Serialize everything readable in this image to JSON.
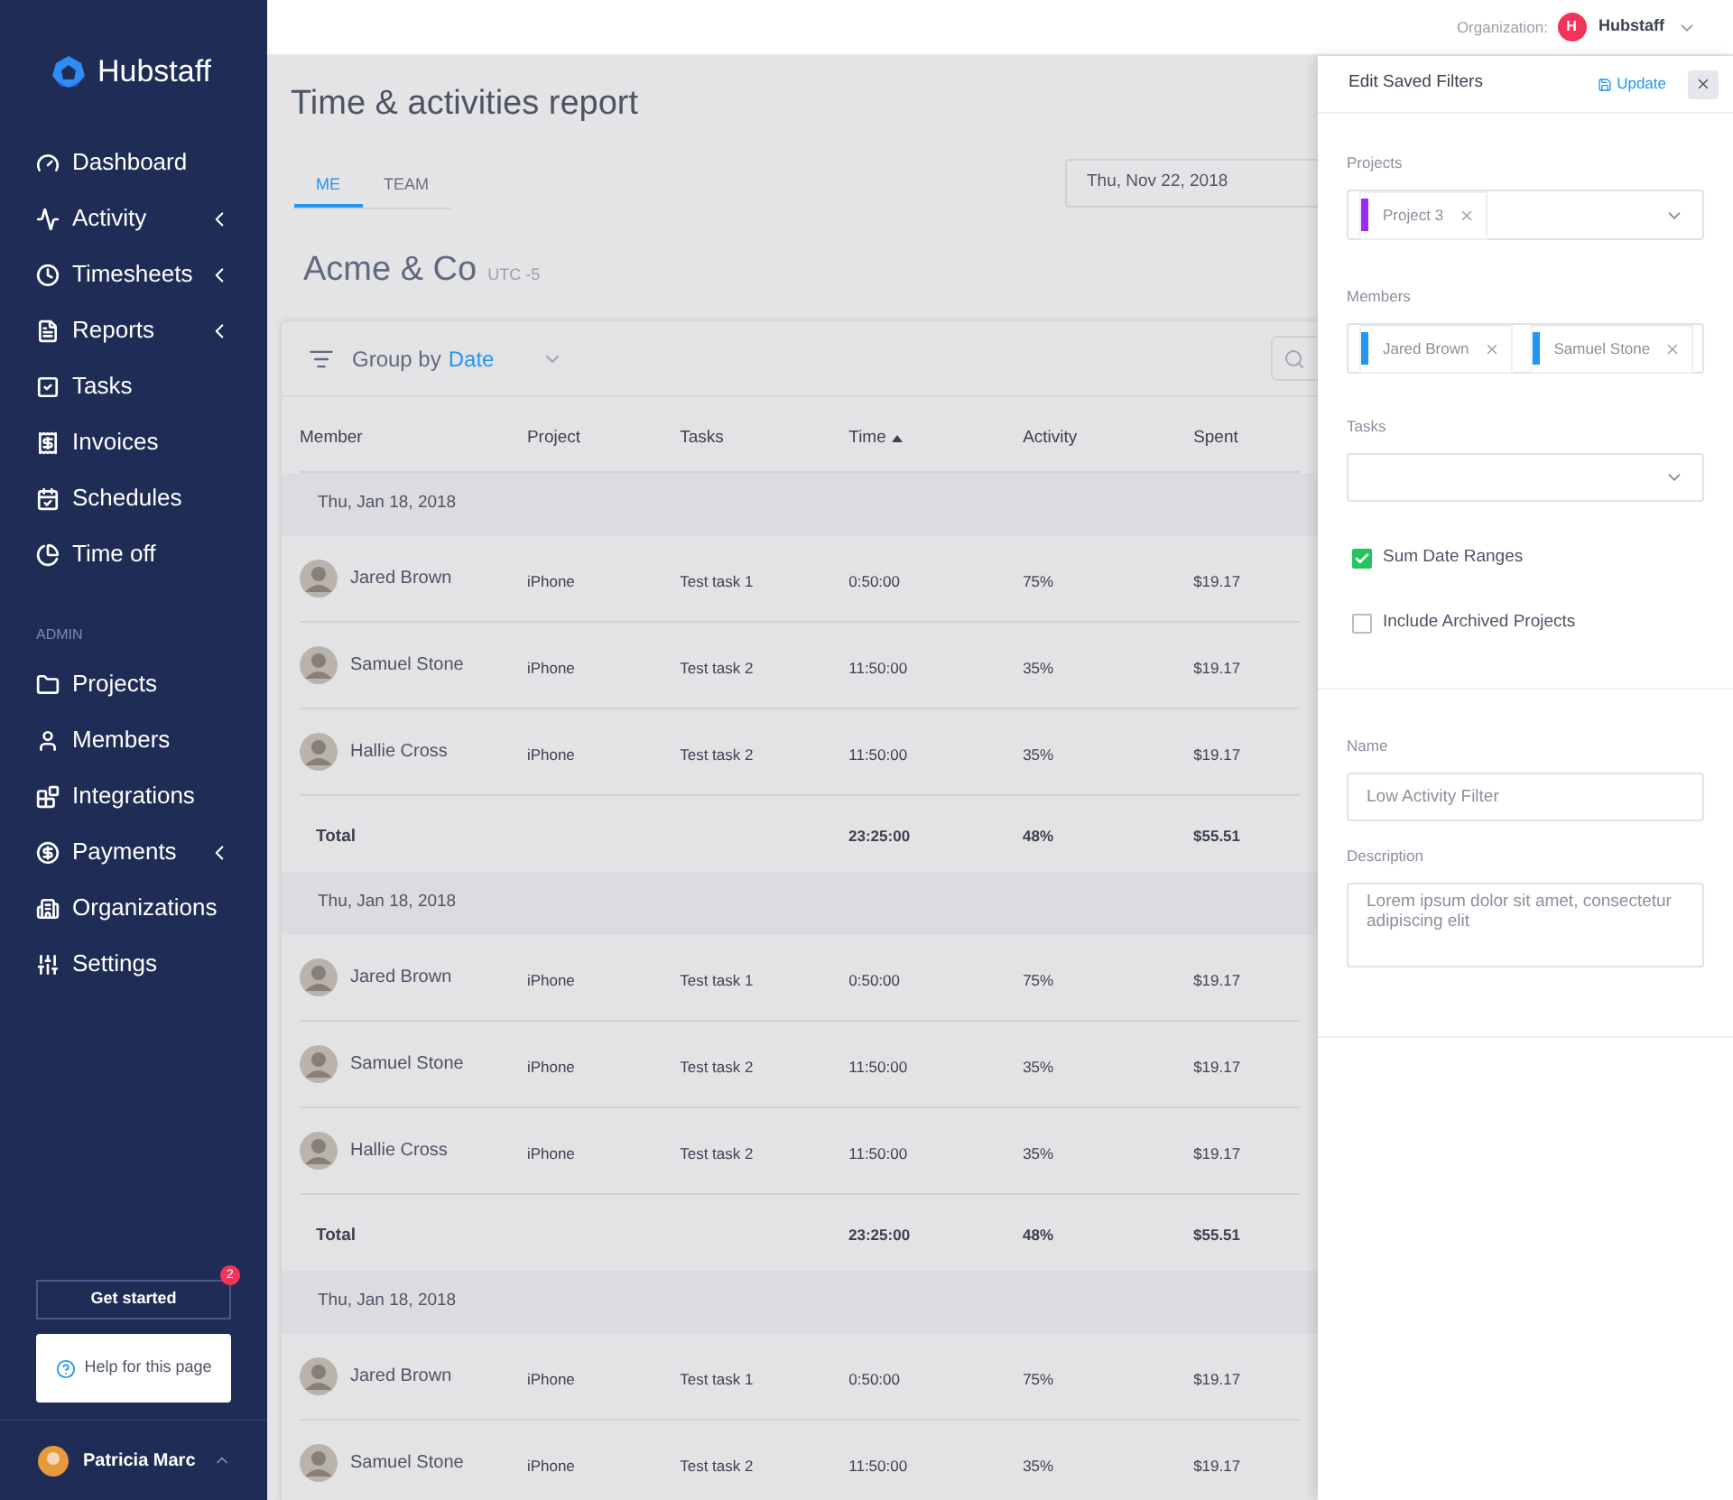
{
  "sidebar": {
    "logo": "Hubstaff",
    "items": [
      {
        "label": "Dashboard",
        "expandable": false
      },
      {
        "label": "Activity",
        "expandable": true
      },
      {
        "label": "Timesheets",
        "expandable": true
      },
      {
        "label": "Reports",
        "expandable": true
      },
      {
        "label": "Tasks",
        "expandable": false
      },
      {
        "label": "Invoices",
        "expandable": false
      },
      {
        "label": "Schedules",
        "expandable": false
      },
      {
        "label": "Time off",
        "expandable": false
      }
    ],
    "section": "ADMIN",
    "admin_items": [
      {
        "label": "Projects",
        "expandable": false
      },
      {
        "label": "Members",
        "expandable": false
      },
      {
        "label": "Integrations",
        "expandable": false
      },
      {
        "label": "Payments",
        "expandable": true
      },
      {
        "label": "Organizations",
        "expandable": false
      },
      {
        "label": "Settings",
        "expandable": false
      }
    ],
    "get_started": {
      "label": "Get started",
      "badge": "2"
    },
    "help": "Help for this page",
    "user": "Patricia Marc"
  },
  "topbar": {
    "org_label": "Organization:",
    "org_initial": "H",
    "org_name": "Hubstaff"
  },
  "page": {
    "title": "Time & activities report",
    "tabs": [
      {
        "label": "ME",
        "selected": true
      },
      {
        "label": "TEAM",
        "selected": false
      }
    ],
    "date": "Thu, Nov 22, 2018",
    "company": "Acme & Co",
    "timezone": "UTC -5"
  },
  "table": {
    "group_by_label": "Group by",
    "group_by_value": "Date",
    "columns": [
      {
        "label": "Member",
        "sorted": false
      },
      {
        "label": "Project",
        "sorted": false
      },
      {
        "label": "Tasks",
        "sorted": false
      },
      {
        "label": "Time",
        "sorted": true
      },
      {
        "label": "Activity",
        "sorted": false
      },
      {
        "label": "Spent",
        "sorted": false
      }
    ],
    "groups": [
      {
        "date": "Thu, Jan 18, 2018",
        "rows": [
          {
            "member": "Jared Brown",
            "project": "iPhone",
            "task": "Test task 1",
            "time": "0:50:00",
            "activity": "75%",
            "spent": "$19.17"
          },
          {
            "member": "Samuel Stone",
            "project": "iPhone",
            "task": "Test task 2",
            "time": "11:50:00",
            "activity": "35%",
            "spent": "$19.17"
          },
          {
            "member": "Hallie Cross",
            "project": "iPhone",
            "task": "Test task 2",
            "time": "11:50:00",
            "activity": "35%",
            "spent": "$19.17"
          }
        ],
        "total": {
          "label": "Total",
          "time": "23:25:00",
          "activity": "48%",
          "spent": "$55.51"
        }
      },
      {
        "date": "Thu, Jan 18, 2018",
        "rows": [
          {
            "member": "Jared Brown",
            "project": "iPhone",
            "task": "Test task 1",
            "time": "0:50:00",
            "activity": "75%",
            "spent": "$19.17"
          },
          {
            "member": "Samuel Stone",
            "project": "iPhone",
            "task": "Test task 2",
            "time": "11:50:00",
            "activity": "35%",
            "spent": "$19.17"
          },
          {
            "member": "Hallie Cross",
            "project": "iPhone",
            "task": "Test task 2",
            "time": "11:50:00",
            "activity": "35%",
            "spent": "$19.17"
          }
        ],
        "total": {
          "label": "Total",
          "time": "23:25:00",
          "activity": "48%",
          "spent": "$55.51"
        }
      },
      {
        "date": "Thu, Jan 18, 2018",
        "rows": [
          {
            "member": "Jared Brown",
            "project": "iPhone",
            "task": "Test task 1",
            "time": "0:50:00",
            "activity": "75%",
            "spent": "$19.17"
          },
          {
            "member": "Samuel Stone",
            "project": "iPhone",
            "task": "Test task 2",
            "time": "11:50:00",
            "activity": "35%",
            "spent": "$19.17"
          }
        ]
      }
    ]
  },
  "panel": {
    "title": "Edit Saved Filters",
    "update": "Update",
    "projects": {
      "label": "Projects",
      "tags": [
        {
          "label": "Project 3",
          "color": "#9b2cf5"
        }
      ]
    },
    "members": {
      "label": "Members",
      "tags": [
        {
          "label": "Jared Brown",
          "color": "#2196f3"
        },
        {
          "label": "Samuel Stone",
          "color": "#2196f3"
        }
      ]
    },
    "tasks": {
      "label": "Tasks"
    },
    "checkboxes": [
      {
        "label": "Sum Date Ranges",
        "checked": true
      },
      {
        "label": "Include Archived Projects",
        "checked": false
      }
    ],
    "name": {
      "label": "Name",
      "value": "Low Activity Filter"
    },
    "description": {
      "label": "Description",
      "value": "Lorem ipsum dolor sit amet, consectetur adipiscing elit"
    }
  }
}
